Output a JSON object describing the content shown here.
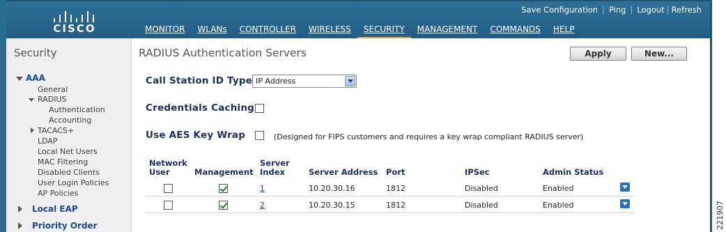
{
  "header": {
    "logo_text": "CISCO",
    "links": [
      "Save Configuration",
      "Ping",
      "Logout",
      "Refresh"
    ],
    "nav_tabs": [
      "MONITOR",
      "WLANs",
      "CONTROLLER",
      "WIRELESS",
      "SECURITY",
      "MANAGEMENT",
      "COMMANDS",
      "HELP"
    ],
    "active_tab": "SECURITY",
    "accent_color": "#f0a23a",
    "bar_color": "#2b6c93"
  },
  "sidebar": {
    "title": "Security",
    "aaa": "AAA",
    "general": "General",
    "radius": "RADIUS",
    "authentication": "Authentication",
    "accounting": "Accounting",
    "tacacs": "TACACS+",
    "ldap": "LDAP",
    "local_net_users": "Local Net Users",
    "mac_filtering": "MAC Filtering",
    "disabled_clients": "Disabled Clients",
    "user_login_policies": "User Login Policies",
    "ap_policies": "AP Policies",
    "local_eap": "Local EAP",
    "priority_order": "Priority Order"
  },
  "main": {
    "title": "RADIUS Authentication Servers",
    "apply_label": "Apply",
    "new_label": "New...",
    "call_station_label": "Call Station ID Type",
    "call_station_value": "IP Address",
    "credentials_label": "Credentials Caching",
    "credentials_checked": false,
    "aes_label": "Use AES Key Wrap",
    "aes_checked": false,
    "aes_note": "(Designed for FIPS customers and requires a key wrap compliant RADIUS server)"
  },
  "table": {
    "headers": {
      "network_user_1": "Network",
      "network_user_2": "User",
      "management": "Management",
      "server_index_1": "Server",
      "server_index_2": "Index",
      "server_address": "Server Address",
      "port": "Port",
      "ipsec": "IPSec",
      "admin_status": "Admin Status"
    },
    "rows": [
      {
        "network_user": false,
        "management": true,
        "index": "1",
        "address": "10.20.30.16",
        "port": "1812",
        "ipsec": "Disabled",
        "status": "Enabled"
      },
      {
        "network_user": false,
        "management": true,
        "index": "2",
        "address": "10.20.30.15",
        "port": "1812",
        "ipsec": "Disabled",
        "status": "Enabled"
      }
    ]
  },
  "figure_id": "221907"
}
